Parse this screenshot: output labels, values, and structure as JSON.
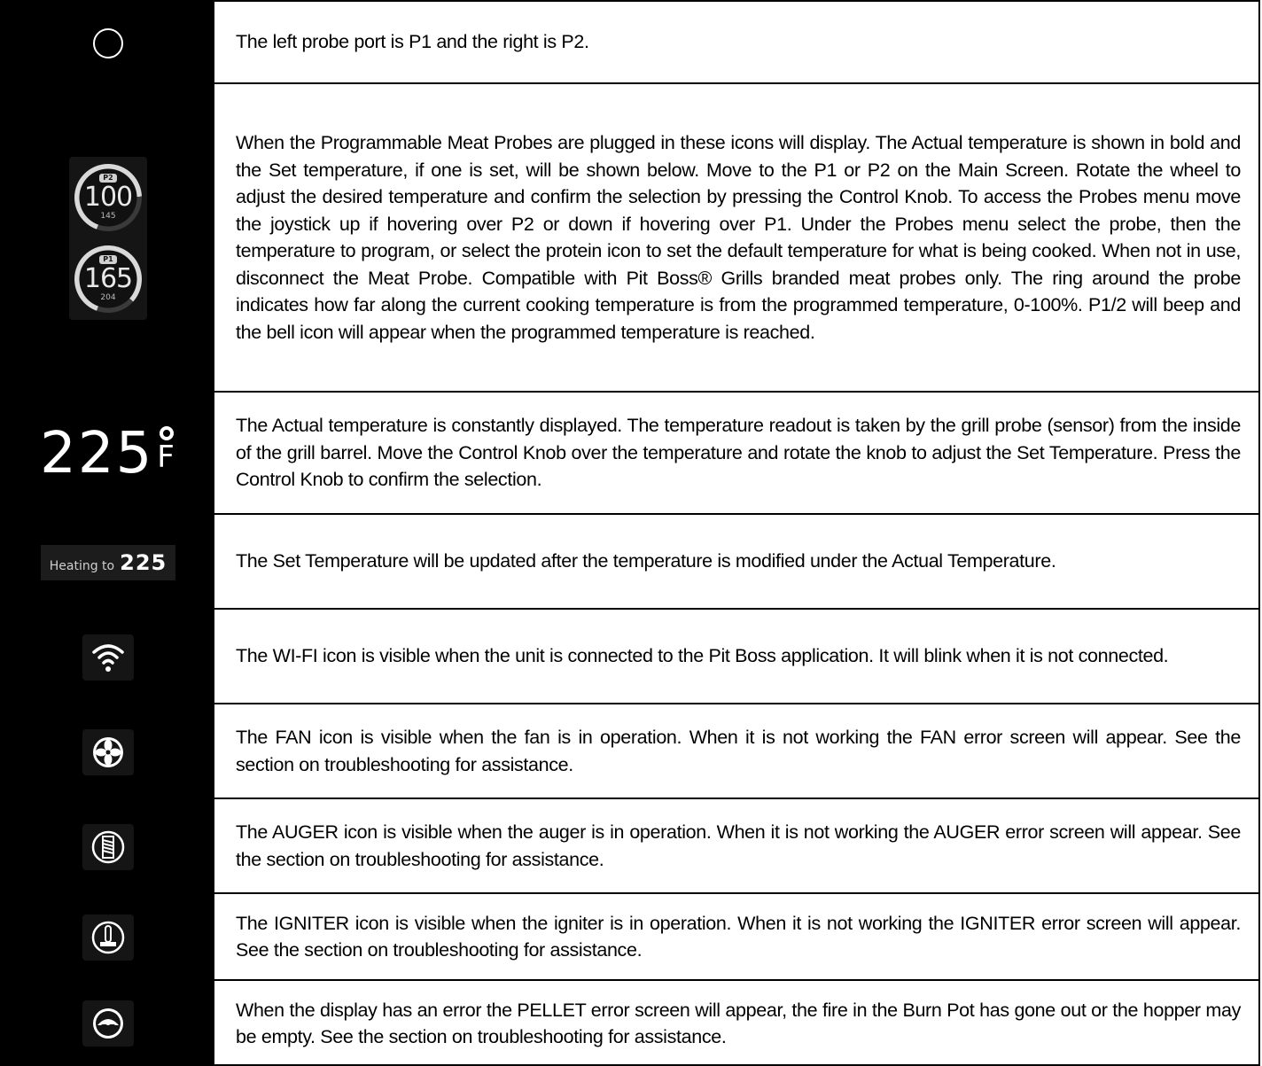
{
  "rows": [
    {
      "icon": "circle-icon",
      "text": "The left probe port is P1 and the right is P2."
    },
    {
      "icon": "meat-probe-icons",
      "text": "When the Programmable Meat Probes are plugged in these icons will display. The Actual temperature is shown in bold and the Set temperature, if one is set, will be shown below. Move to the P1 or P2 on the Main Screen. Rotate the wheel to adjust the desired temperature and confirm the selection by pressing the Control Knob. To access the Probes menu move the joystick up if hovering over P2 or down if hovering over P1. Under the Probes menu select the probe, then the temperature to program, or select the protein icon to set the default temperature for what is being cooked. When not in use, disconnect the Meat Probe. Compatible with Pit Boss® Grills branded meat probes only. The ring around the probe indicates how far along the current cooking temperature is from the programmed temperature, 0-100%. P1/2 will beep and the bell icon will appear when the programmed temperature is reached."
    },
    {
      "icon": "actual-temperature-display",
      "text": "The Actual temperature is constantly displayed. The temperature readout is taken by the grill probe (sensor) from the inside of the grill barrel. Move the Control Knob over the temperature and rotate the knob to adjust the Set Temperature. Press the Control Knob to confirm the selection."
    },
    {
      "icon": "set-temperature-display",
      "text": "The Set Temperature will be updated after the temperature is modified under the Actual Temperature."
    },
    {
      "icon": "wifi-icon",
      "text": "The WI-FI icon is visible when the unit is connected to the Pit Boss application. It will blink when it is not connected."
    },
    {
      "icon": "fan-icon",
      "text": "The FAN icon is visible when the fan is in operation. When it is not working the FAN error screen will appear. See the section on troubleshooting for assistance."
    },
    {
      "icon": "auger-icon",
      "text": "The AUGER icon is visible when the auger is in operation. When it is not working the AUGER error screen will appear. See the section on troubleshooting for assistance."
    },
    {
      "icon": "igniter-icon",
      "text": "The IGNITER icon is visible when the igniter is in operation. When it is not working the IGNITER error screen will appear. See the section on troubleshooting for assistance."
    },
    {
      "icon": "pellet-icon",
      "text": "When the display has an error the PELLET error screen will appear, the fire in the Burn Pot has gone out or the hopper may be empty. See the section on troubleshooting for assistance."
    }
  ],
  "probes": [
    {
      "tag": "P2",
      "actual": "100",
      "set": "145",
      "ring_fraction": 0.69
    },
    {
      "tag": "P1",
      "actual": "165",
      "set": "204",
      "ring_fraction": 0.81
    }
  ],
  "actual_temp": {
    "value": "225",
    "unit": "F"
  },
  "heating": {
    "label": "Heating to",
    "value": "225"
  }
}
